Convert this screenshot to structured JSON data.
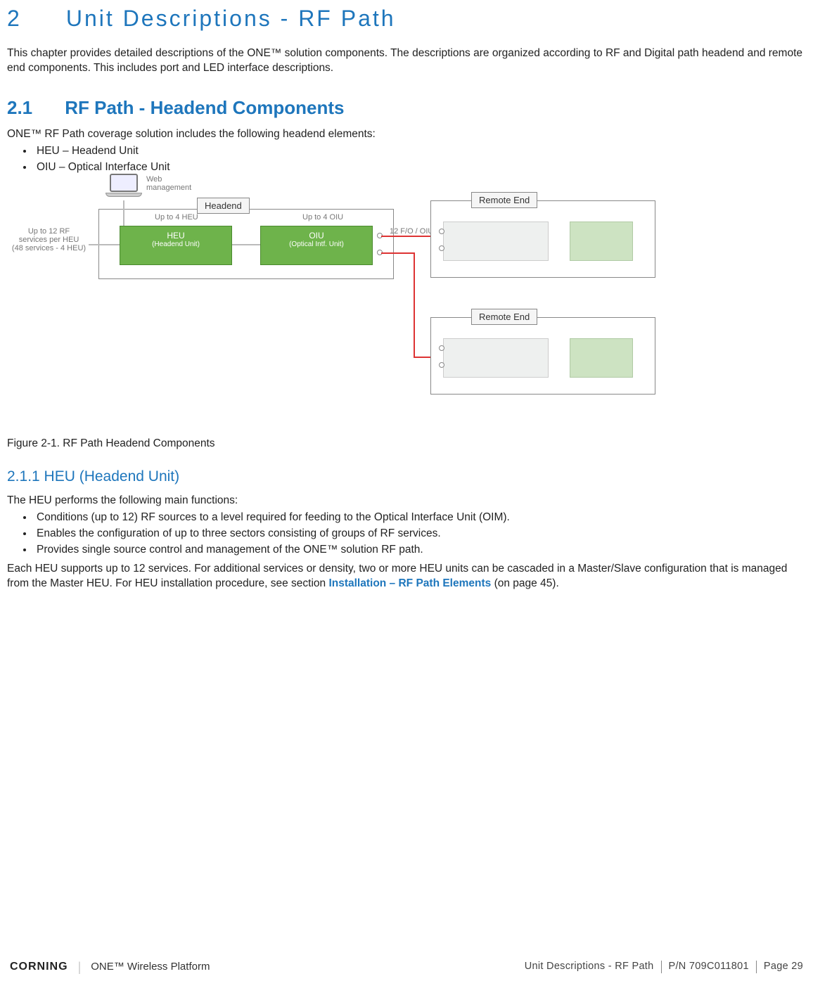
{
  "chapter": {
    "num": "2",
    "title": "Unit Descriptions - RF Path"
  },
  "intro": "This chapter provides detailed descriptions of the ONE™ solution components. The descriptions are organized according to RF and Digital path headend and remote end components. This includes port and LED interface descriptions.",
  "s21": {
    "num": "2.1",
    "title": "RF Path - Headend Components",
    "lead": "ONE™ RF Path coverage solution includes the following headend elements:",
    "bullets": [
      "HEU – Headend Unit",
      "OIU – Optical Interface Unit"
    ]
  },
  "diagram": {
    "web_mgmt": "Web\nmanagement",
    "headend_label": "Headend",
    "up_heu": "Up to 4 HEU",
    "up_oiu": "Up to 4 OIU",
    "heu_title": "HEU",
    "heu_sub": "(Headend Unit)",
    "oiu_title": "OIU",
    "oiu_sub": "(Optical Intf. Unit)",
    "left_note": "Up to 12 RF\nservices per HEU\n(48 services - 4 HEU)",
    "fiber_note": "12 F/O / OIU",
    "remote_label": "Remote End"
  },
  "fig_caption": "Figure 2-1. RF Path Headend Components",
  "s211": {
    "title": "2.1.1 HEU (Headend Unit)",
    "lead": "The HEU performs the following main functions:",
    "bullets": [
      "Conditions (up to 12) RF sources to a level required for feeding to the Optical Interface Unit (OIM).",
      "Enables the configuration of up to three sectors consisting of groups of RF services.",
      "Provides single source control and management of the ONE™ solution RF path."
    ],
    "para_a": "Each HEU supports up to 12 services. For additional services or density, two or more HEU units can be cascaded in a Master/Slave configuration that is managed from the Master HEU. For HEU installation procedure, see section ",
    "link": "Installation – RF Path Elements",
    "para_b": " (on page 45)."
  },
  "footer": {
    "brand": "CORNING",
    "platform": "ONE™ Wireless Platform",
    "section": "Unit Descriptions - RF Path",
    "pn": "P/N 709C011801",
    "page": "Page 29"
  }
}
